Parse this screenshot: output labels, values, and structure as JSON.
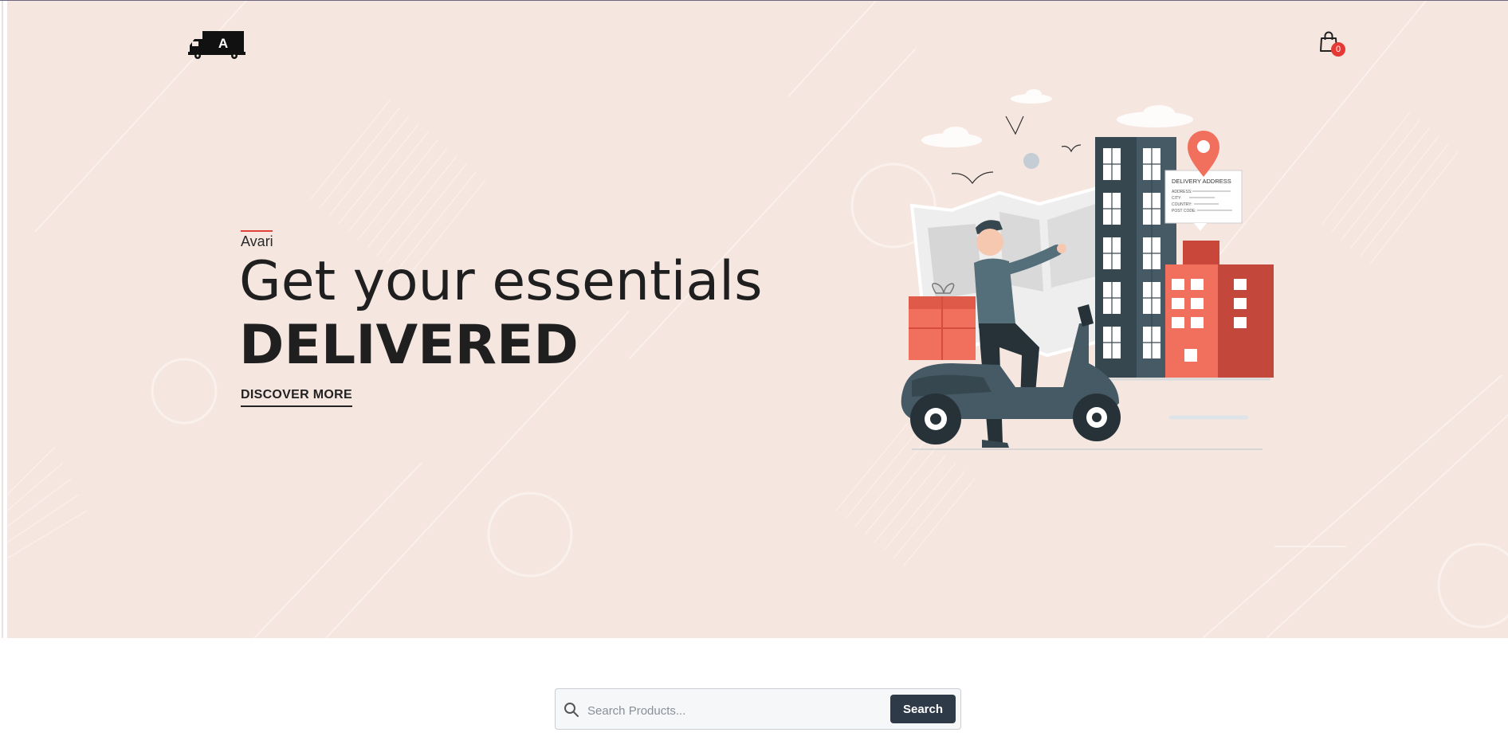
{
  "header": {
    "logo_letter": "A",
    "logo_icon": "delivery-truck-logo",
    "cart_icon": "shopping-bag-icon",
    "cart_count": "0"
  },
  "hero": {
    "brand": "Avari",
    "title_line1": "Get your essentials",
    "title_line2": "DELIVERED",
    "cta_label": "DISCOVER MORE",
    "illustration": {
      "card_title": "DELIVERY ADDRESS",
      "card_fields": [
        "ADDRESS:",
        "CITY:",
        "COUNTRY:",
        "POST CODE:"
      ]
    }
  },
  "search": {
    "placeholder": "Search Products...",
    "button_label": "Search",
    "icon": "search-icon"
  },
  "colors": {
    "hero_bg": "#f5e6e0",
    "accent": "#e0413a",
    "dark": "#2f3a48",
    "badge": "#e53935"
  }
}
